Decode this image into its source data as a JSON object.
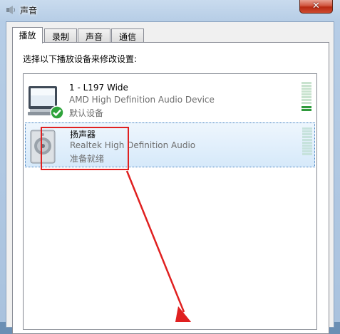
{
  "window": {
    "title": "声音",
    "close_label": "✕"
  },
  "tabs": [
    {
      "label": "播放",
      "active": true
    },
    {
      "label": "录制",
      "active": false
    },
    {
      "label": "声音",
      "active": false
    },
    {
      "label": "通信",
      "active": false
    }
  ],
  "instruction": "选择以下播放设备来修改设置:",
  "devices": [
    {
      "name": "1 - L197 Wide",
      "description": "AMD High Definition Audio Device",
      "status": "默认设备",
      "icon": "monitor-icon",
      "badge": "default-check-icon",
      "selected": false
    },
    {
      "name": "扬声器",
      "description": "Realtek High Definition Audio",
      "status": "准备就绪",
      "icon": "speaker-icon",
      "selected": true
    }
  ],
  "colors": {
    "annotation": "#e02020",
    "meter_active": "#2f9a3c",
    "selection": "#d6e9fa"
  }
}
